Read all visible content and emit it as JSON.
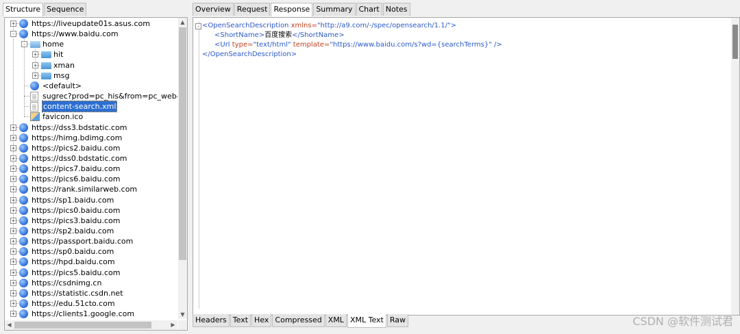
{
  "left": {
    "tabs": [
      "Structure",
      "Sequence"
    ],
    "tree": [
      {
        "label": "https://liveupdate01s.asus.com",
        "icon": "globe",
        "level": 0,
        "exp": "+"
      },
      {
        "label": "https://www.baidu.com",
        "icon": "globe",
        "level": 0,
        "exp": "-"
      },
      {
        "label": "home",
        "icon": "folder-open",
        "level": 1,
        "exp": "-"
      },
      {
        "label": "hit",
        "icon": "folder",
        "level": 2,
        "exp": "+"
      },
      {
        "label": "xman",
        "icon": "folder",
        "level": 2,
        "exp": "+"
      },
      {
        "label": "msg",
        "icon": "folder",
        "level": 2,
        "exp": "+"
      },
      {
        "label": "<default>",
        "icon": "globe",
        "level": 1,
        "exp": ""
      },
      {
        "label": "sugrec?prod=pc_his&from=pc_web&jso",
        "icon": "doc",
        "level": 1,
        "exp": ""
      },
      {
        "label": "content-search.xml",
        "icon": "doc",
        "level": 1,
        "exp": "",
        "selected": true
      },
      {
        "label": "favicon.ico",
        "icon": "image",
        "level": 1,
        "exp": ""
      },
      {
        "label": "https://dss3.bdstatic.com",
        "icon": "globe",
        "level": 0,
        "exp": "+"
      },
      {
        "label": "https://himg.bdimg.com",
        "icon": "globe",
        "level": 0,
        "exp": "+"
      },
      {
        "label": "https://pics2.baidu.com",
        "icon": "globe",
        "level": 0,
        "exp": "+"
      },
      {
        "label": "https://dss0.bdstatic.com",
        "icon": "globe",
        "level": 0,
        "exp": "+"
      },
      {
        "label": "https://pics7.baidu.com",
        "icon": "globe",
        "level": 0,
        "exp": "+"
      },
      {
        "label": "https://pics6.baidu.com",
        "icon": "globe",
        "level": 0,
        "exp": "+"
      },
      {
        "label": "https://rank.similarweb.com",
        "icon": "globe",
        "level": 0,
        "exp": "+"
      },
      {
        "label": "https://sp1.baidu.com",
        "icon": "globe",
        "level": 0,
        "exp": "+"
      },
      {
        "label": "https://pics0.baidu.com",
        "icon": "globe",
        "level": 0,
        "exp": "+"
      },
      {
        "label": "https://pics3.baidu.com",
        "icon": "globe",
        "level": 0,
        "exp": "+"
      },
      {
        "label": "https://sp2.baidu.com",
        "icon": "globe",
        "level": 0,
        "exp": "+"
      },
      {
        "label": "https://passport.baidu.com",
        "icon": "globe",
        "level": 0,
        "exp": "+"
      },
      {
        "label": "https://sp0.baidu.com",
        "icon": "globe",
        "level": 0,
        "exp": "+"
      },
      {
        "label": "https://hpd.baidu.com",
        "icon": "globe",
        "level": 0,
        "exp": "+"
      },
      {
        "label": "https://pics5.baidu.com",
        "icon": "globe",
        "level": 0,
        "exp": "+"
      },
      {
        "label": "https://csdnimg.cn",
        "icon": "globe",
        "level": 0,
        "exp": "+"
      },
      {
        "label": "https://statistic.csdn.net",
        "icon": "globe",
        "level": 0,
        "exp": "+"
      },
      {
        "label": "https://edu.51cto.com",
        "icon": "globe",
        "level": 0,
        "exp": "+"
      },
      {
        "label": "https://clients1.google.com",
        "icon": "globe",
        "level": 0,
        "exp": "+"
      }
    ]
  },
  "right": {
    "tabs": [
      "Overview",
      "Request",
      "Response",
      "Summary",
      "Chart",
      "Notes"
    ],
    "active_tab": "Response",
    "bottom_tabs": [
      "Headers",
      "Text",
      "Hex",
      "Compressed",
      "XML",
      "XML Text",
      "Raw"
    ],
    "active_bottom_tab": "XML Text",
    "xml": {
      "collapse": "-",
      "line1": {
        "open": "<OpenSearchDescription",
        "attr": " xmlns=",
        "val": "\"http://a9.com/-/spec/opensearch/1.1/\"",
        "close": ">"
      },
      "line2": {
        "open": "<ShortName",
        "gt": ">",
        "text": "百度搜索",
        "end": "</ShortName>"
      },
      "line3": {
        "open": "<Url",
        "a1": " type=",
        "v1": "\"text/html\"",
        "a2": " template=",
        "v2": "\"https://www.baidu.com/s?wd={searchTerms}\"",
        "end": " />"
      },
      "line4": {
        "end": "</OpenSearchDescription>"
      }
    }
  },
  "watermark": "CSDN @软件测试君"
}
